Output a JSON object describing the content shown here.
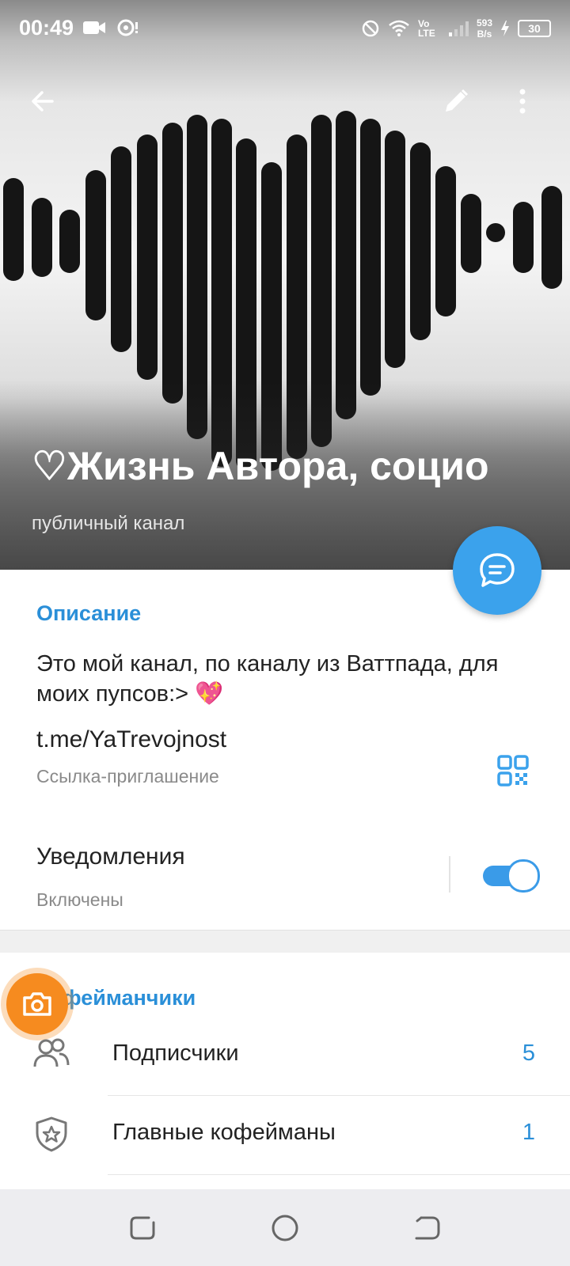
{
  "status_bar": {
    "time": "00:49",
    "network": "Vo LTE",
    "speed_value": "593",
    "speed_unit": "B/s",
    "battery": "30"
  },
  "header": {
    "title": "♡Жизнь Автора, социо",
    "subtitle": "публичный канал",
    "back_icon": "arrow-left-icon",
    "edit_icon": "pencil-icon",
    "more_icon": "more-vertical-icon"
  },
  "description": {
    "label": "Описание",
    "text": "Это мой канал, по каналу из Ваттпада, для моих пупсов:>",
    "emoji": "💖"
  },
  "link": {
    "value": "t.me/YaTrevojnost",
    "caption": "Ссылка-приглашение"
  },
  "notifications": {
    "label": "Уведомления",
    "status": "Включены",
    "enabled": true
  },
  "members_section": {
    "title": "Кофейманчики",
    "items": [
      {
        "label": "Подписчики",
        "count": "5",
        "icon": "people-icon"
      },
      {
        "label": "Главные кофейманы",
        "count": "1",
        "icon": "shield-star-icon"
      }
    ]
  },
  "colors": {
    "accent": "#3ba2ec",
    "camera": "#f68b1f"
  }
}
